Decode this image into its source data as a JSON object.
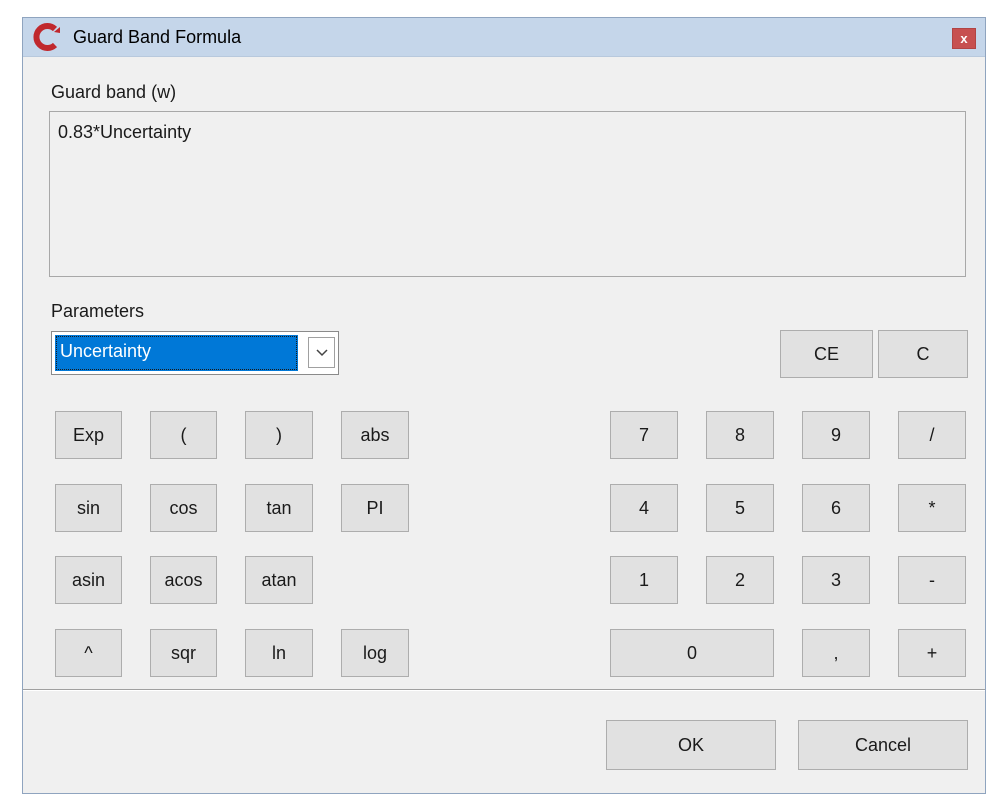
{
  "window": {
    "title": "Guard Band Formula",
    "close_glyph": "x",
    "icon": "app-logo-c-icon"
  },
  "formula": {
    "label": "Guard band (w)",
    "value": "0.83*Uncertainty"
  },
  "parameters": {
    "label": "Parameters",
    "selected": "Uncertainty"
  },
  "buttons": {
    "ce": "CE",
    "c": "C",
    "functions": [
      [
        "Exp",
        "(",
        ")",
        "abs"
      ],
      [
        "sin",
        "cos",
        "tan",
        "PI"
      ],
      [
        "asin",
        "acos",
        "atan"
      ],
      [
        "^",
        "sqr",
        "ln",
        "log"
      ]
    ],
    "digits": [
      [
        "7",
        "8",
        "9",
        "/"
      ],
      [
        "4",
        "5",
        "6",
        "*"
      ],
      [
        "1",
        "2",
        "3",
        "-"
      ],
      [
        "0",
        ",",
        "+"
      ]
    ],
    "ok": "OK",
    "cancel": "Cancel"
  },
  "colors": {
    "titlebar": "#c5d6ea",
    "close": "#c75050",
    "selection": "#0078d7",
    "logo": "#c0282d"
  }
}
